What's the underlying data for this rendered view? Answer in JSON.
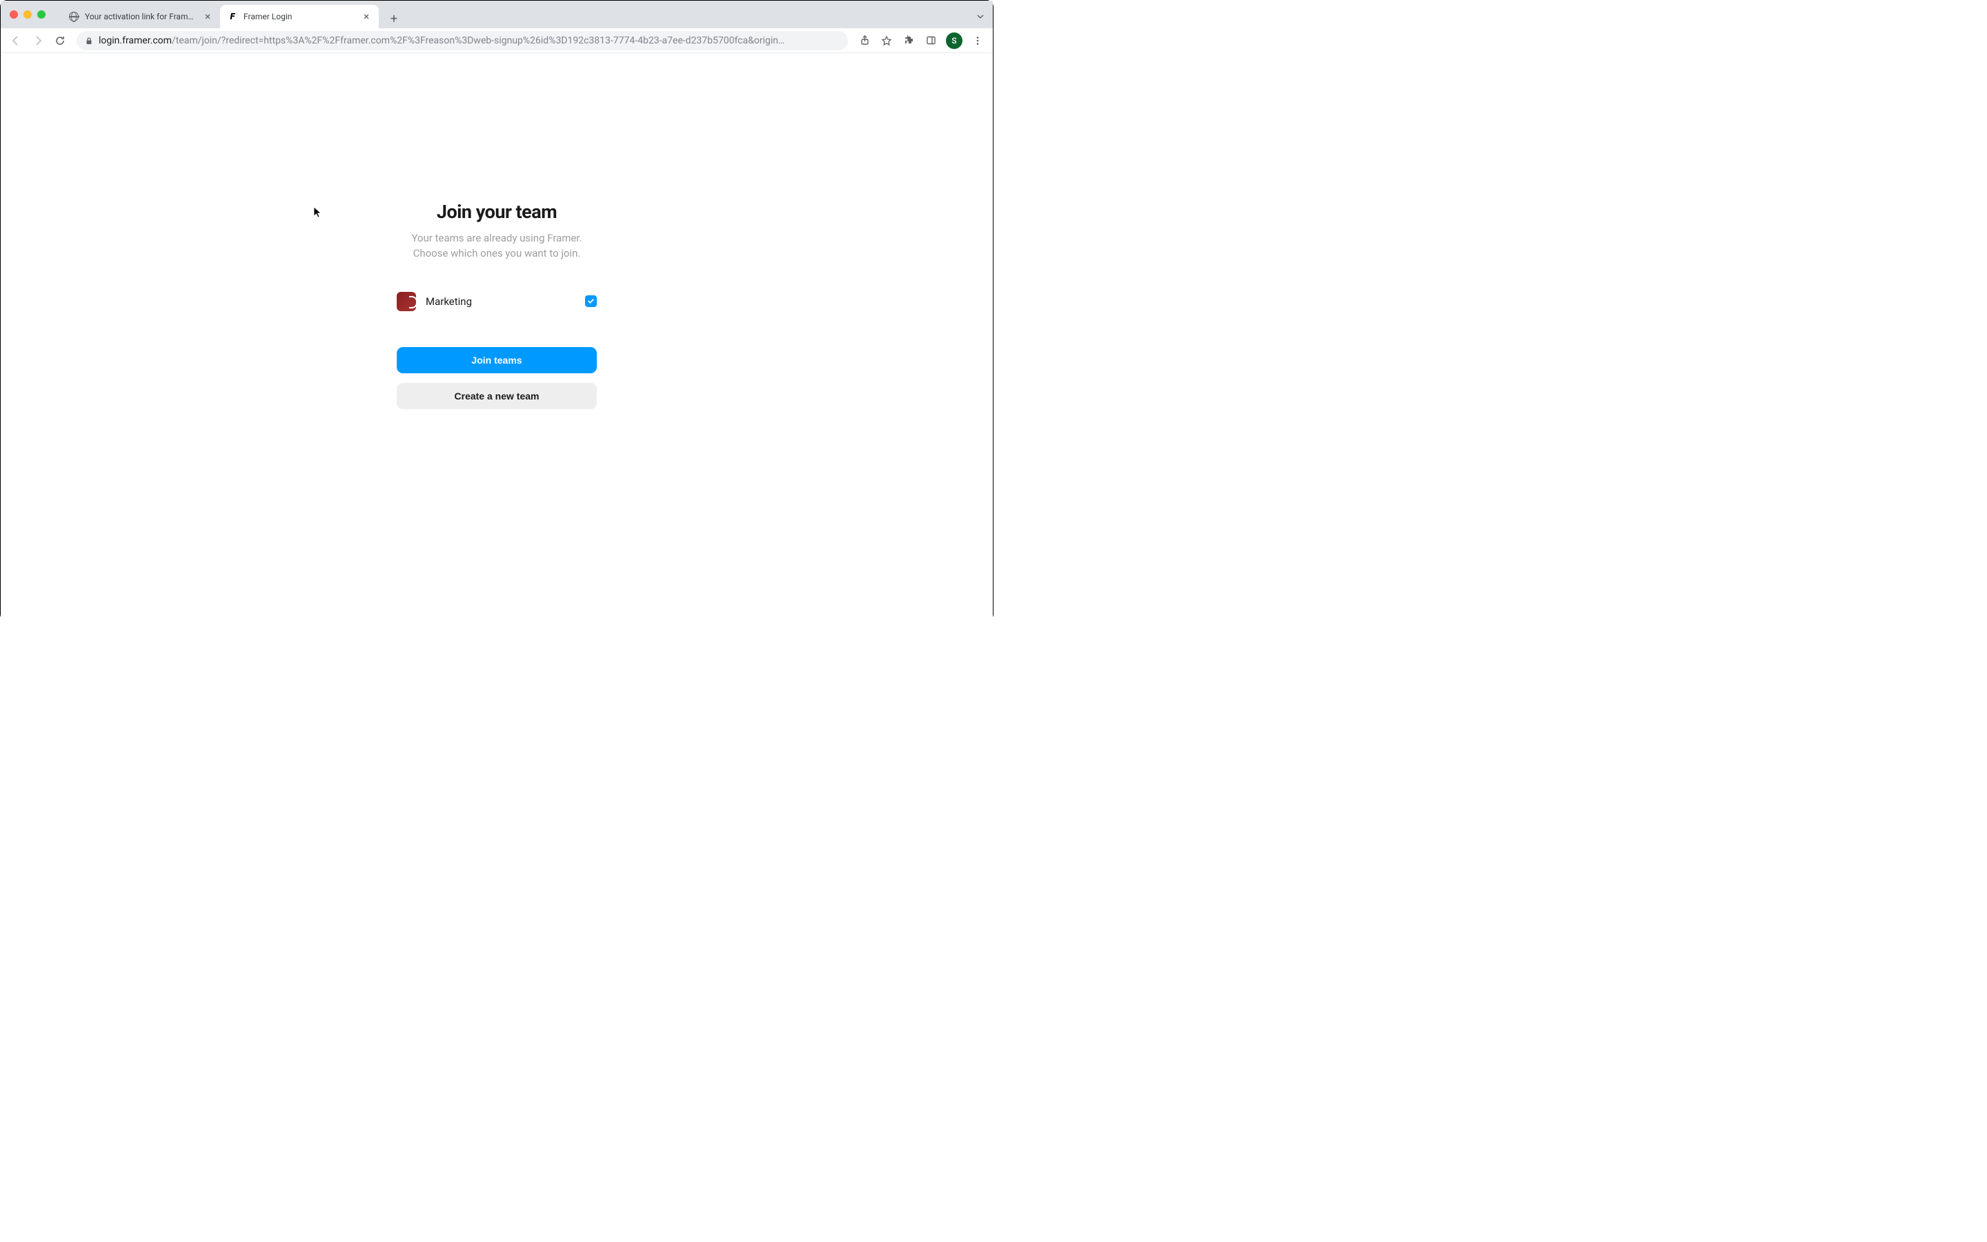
{
  "browser": {
    "tabs": [
      {
        "title": "Your activation link for Framer.",
        "active": false
      },
      {
        "title": "Framer Login",
        "active": true
      }
    ],
    "url_domain": "login.framer.com",
    "url_path": "/team/join/?redirect=https%3A%2F%2Fframer.com%2F%3Freason%3Dweb-signup%26id%3D192c3813-7774-4b23-a7ee-d237b5700fca&origin…",
    "profile_initial": "S"
  },
  "page": {
    "title": "Join your team",
    "subtitle_line1": "Your teams are already using Framer.",
    "subtitle_line2": "Choose which ones you want to join.",
    "teams": [
      {
        "name": "Marketing",
        "selected": true
      }
    ],
    "primary_button": "Join teams",
    "secondary_button": "Create a new team"
  }
}
